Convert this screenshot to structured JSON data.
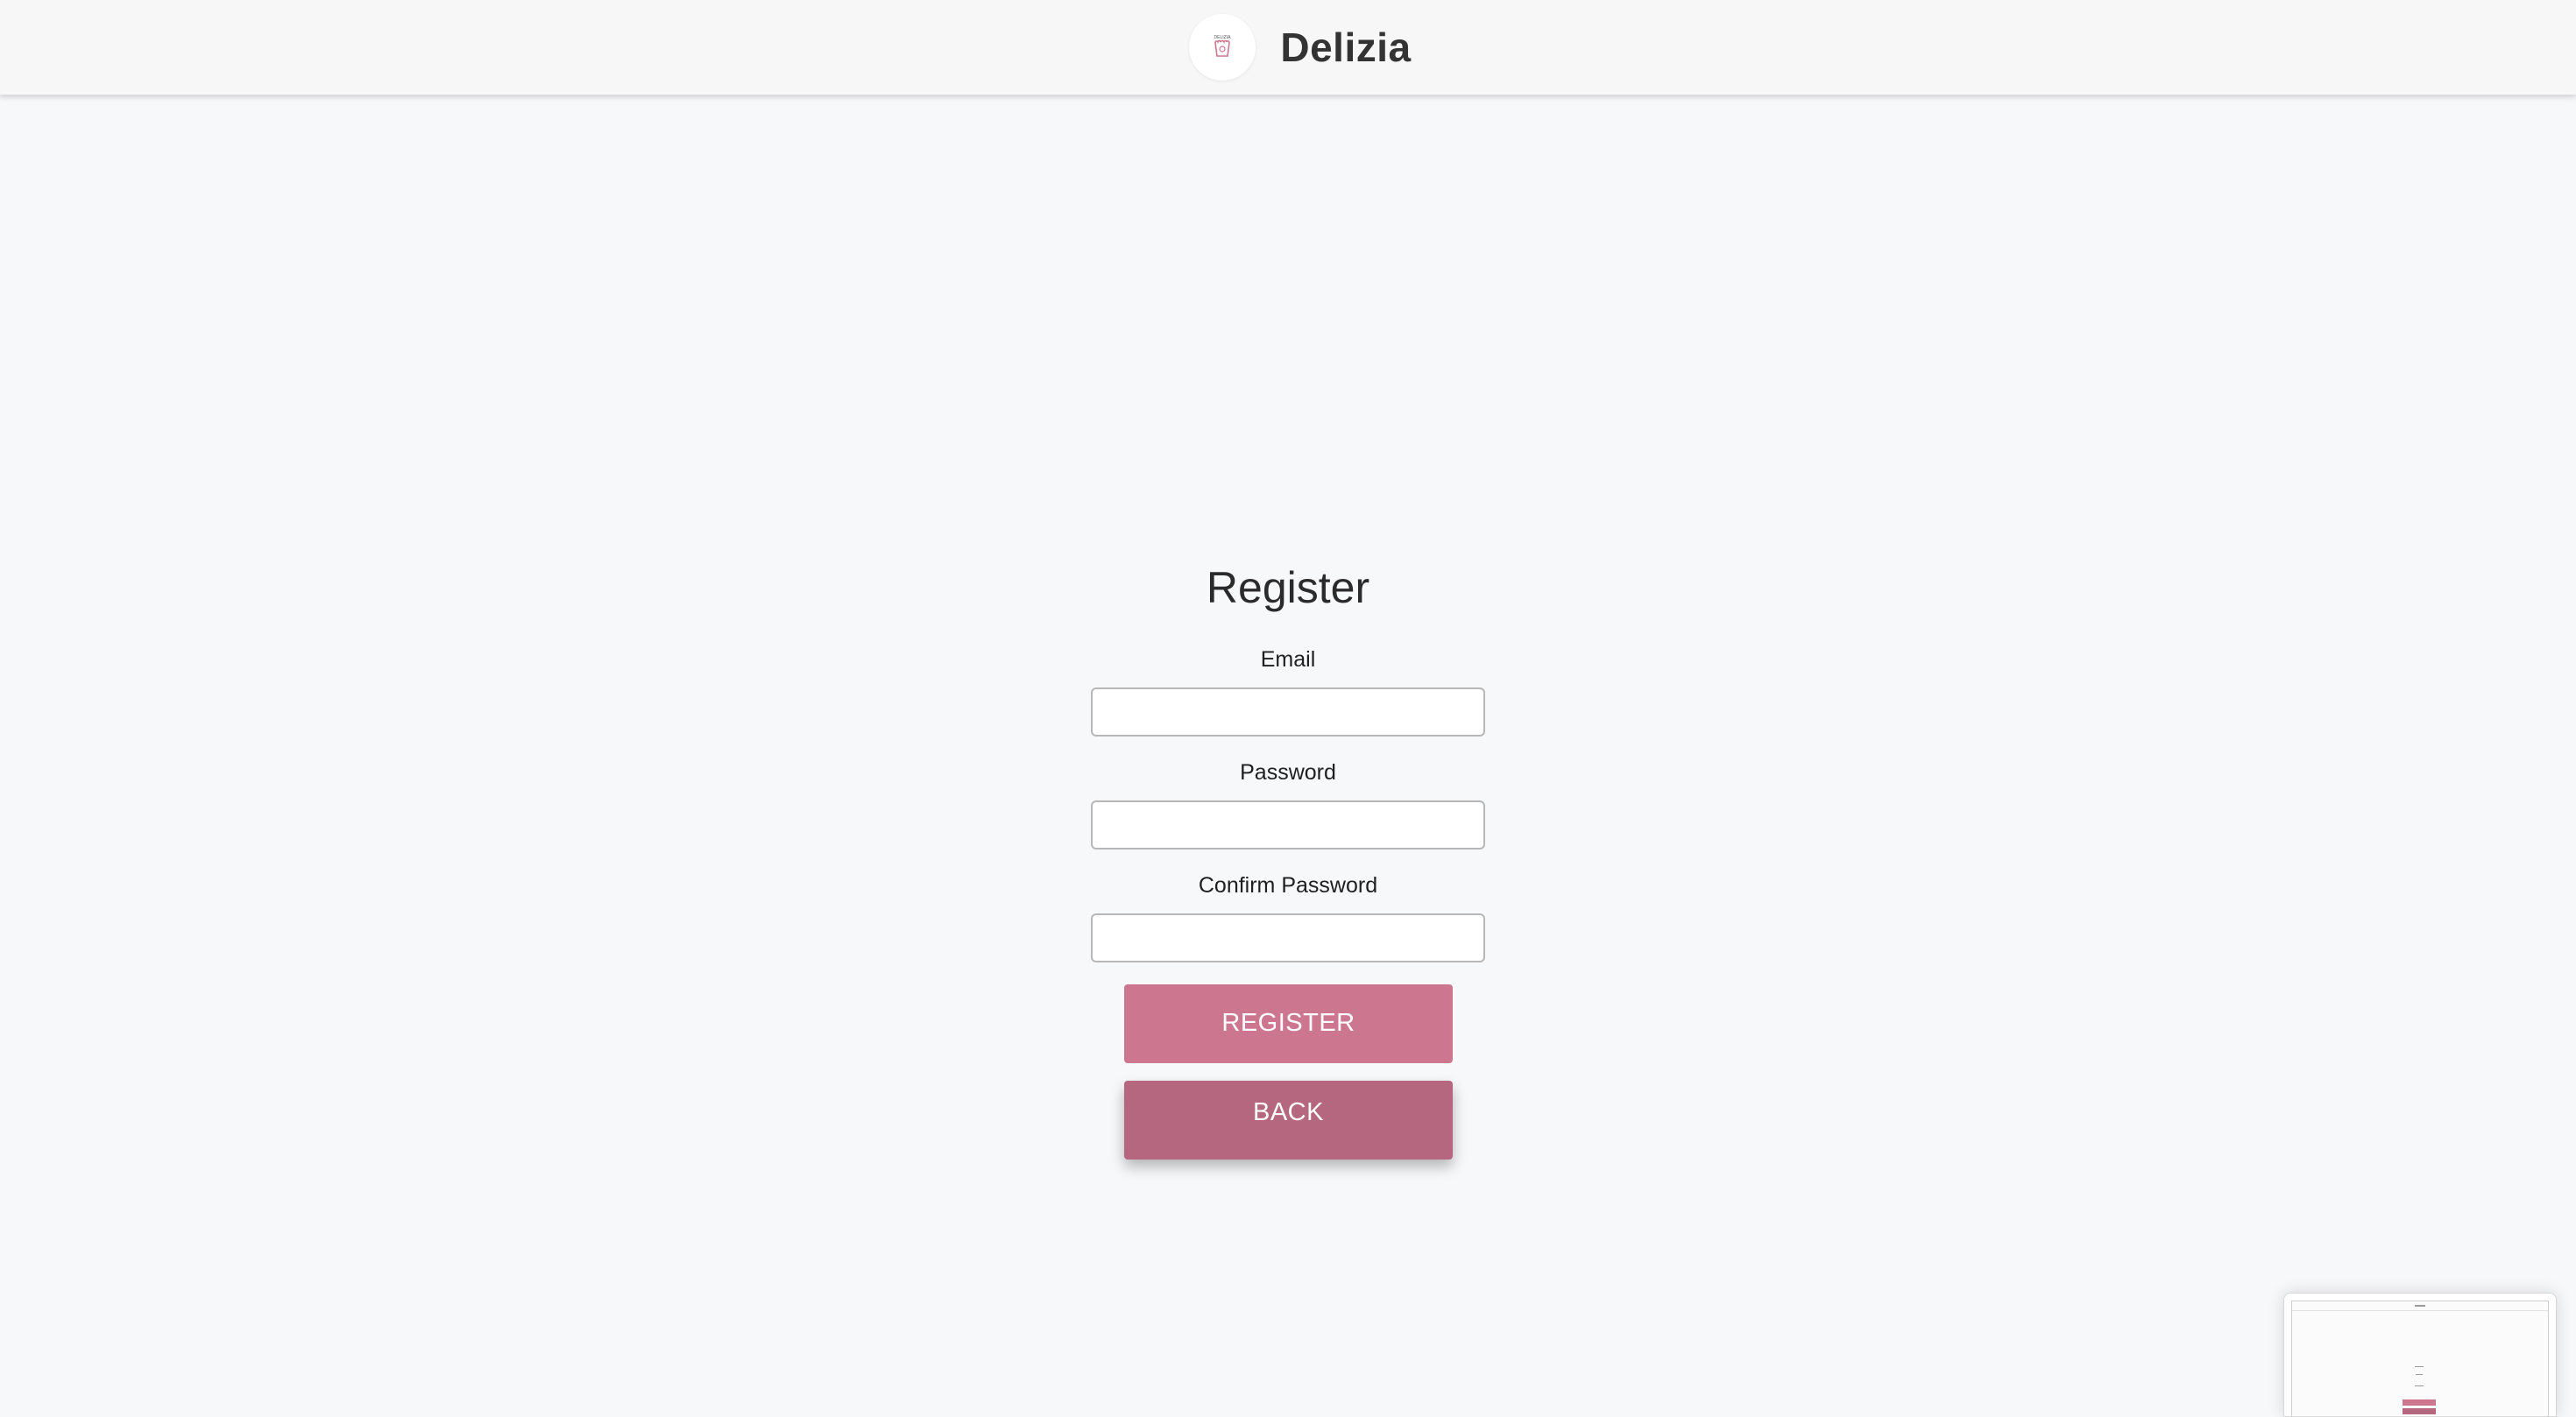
{
  "header": {
    "brand_name": "Delizia",
    "logo_icon": "delizia-logo-icon",
    "logo_icon_color": "#cd7690"
  },
  "register_form": {
    "title": "Register",
    "email_label": "Email",
    "email_value": "",
    "password_label": "Password",
    "password_value": "",
    "confirm_password_label": "Confirm Password",
    "confirm_password_value": "",
    "register_button_label": "REGISTER",
    "back_button_label": "BACK"
  },
  "colors": {
    "page_background": "#f7f8fa",
    "register_button": "#cd7690",
    "back_button": "#b4677f"
  },
  "preview_thumbnail": {
    "icon": "page-preview-thumbnail"
  }
}
